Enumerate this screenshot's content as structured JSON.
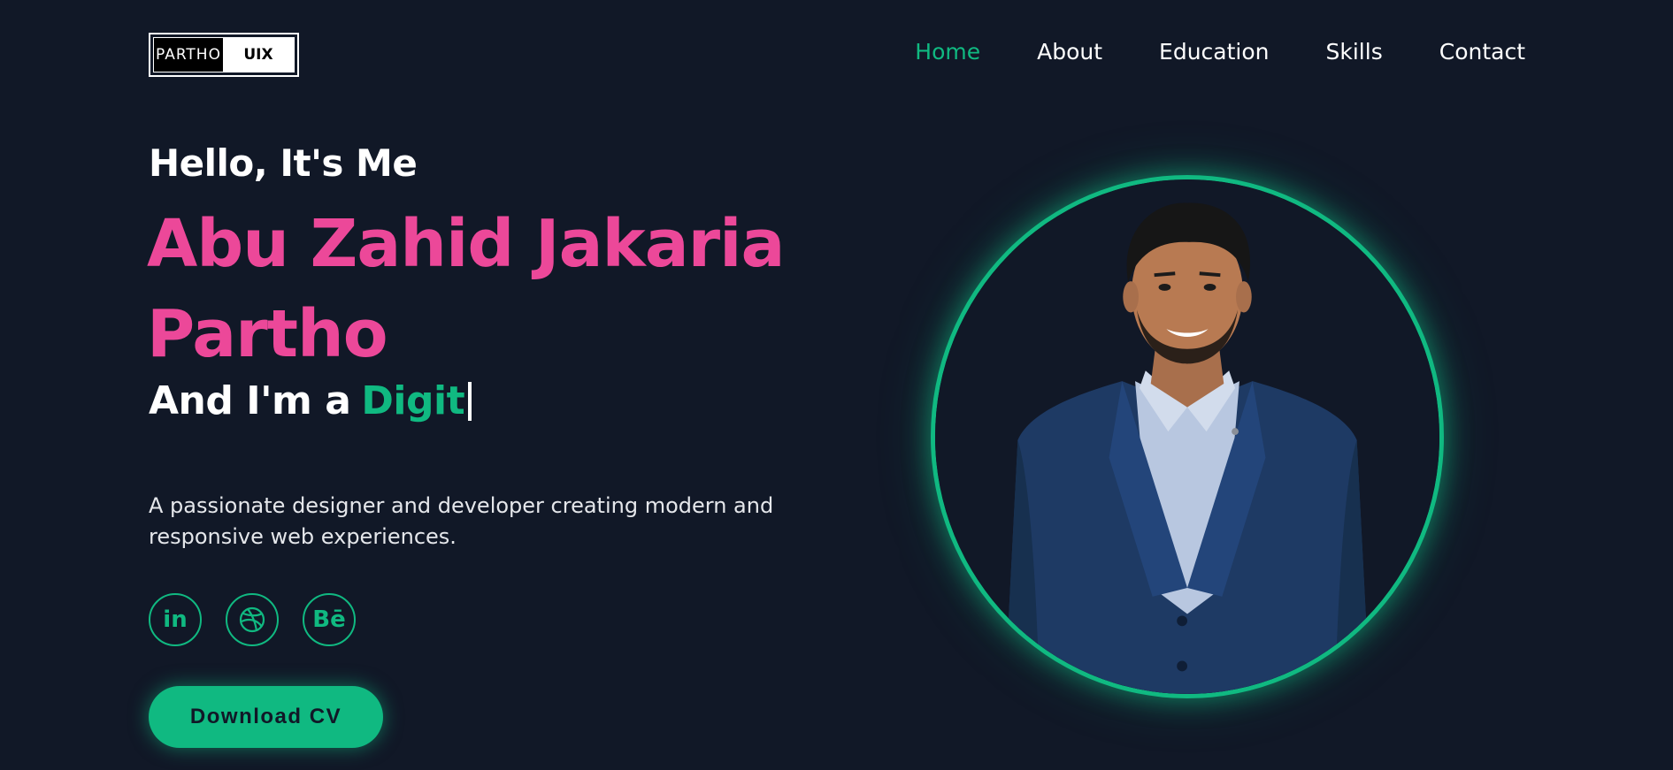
{
  "logo": {
    "left": "PARTHO",
    "right": "UIX"
  },
  "nav": {
    "items": [
      {
        "label": "Home",
        "active": true
      },
      {
        "label": "About",
        "active": false
      },
      {
        "label": "Education",
        "active": false
      },
      {
        "label": "Skills",
        "active": false
      },
      {
        "label": "Contact",
        "active": false
      }
    ]
  },
  "hero": {
    "greeting": "Hello, It's Me",
    "name_line1": "Abu Zahid Jakaria",
    "name_line2": "Partho",
    "role_prefix": "And I'm a",
    "role_typed": "Digit",
    "description": "A passionate designer and developer creating modern and responsive web experiences.",
    "download_label": "Download CV"
  },
  "socials": [
    {
      "icon": "linkedin-icon",
      "glyph": "in"
    },
    {
      "icon": "dribbble-icon",
      "glyph": ""
    },
    {
      "icon": "behance-icon",
      "glyph": "Bē"
    }
  ],
  "colors": {
    "background": "#111827",
    "accent_green": "#10b981",
    "accent_pink": "#ec4899",
    "text": "#ffffff"
  }
}
